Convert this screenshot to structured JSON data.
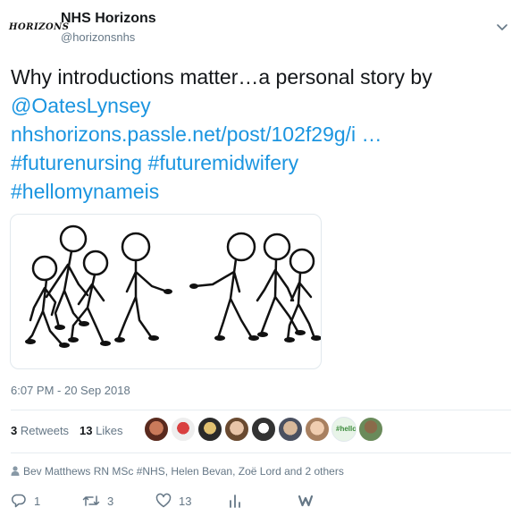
{
  "header": {
    "logo_text": "HORIZONS",
    "name": "NHS Horizons",
    "handle": "@horizonsnhs",
    "menu_icon": "chevron-down-icon"
  },
  "tweet": {
    "text_plain": "Why introductions matter…a personal story by ",
    "mention": "@OatesLynsey",
    "link": "nhshorizons.passle.net/post/102f29g/i …",
    "hashtag1": "#futurenursing",
    "hashtag2": "#futuremidwifery",
    "hashtag3": "#hellomynameis",
    "link_color": "#1b95e0"
  },
  "media": {
    "description_icon": "stick-figures-illustration"
  },
  "timestamp": "6:07 PM - 20 Sep 2018",
  "stats": {
    "retweets_count": "3",
    "retweets_label": "Retweets",
    "likes_count": "13",
    "likes_label": "Likes"
  },
  "liked_by": "Bev Matthews RN MSc #NHS, Helen Bevan, Zoë Lord and 2 others",
  "actions": {
    "replies": "1",
    "retweets": "3",
    "likes": "13"
  }
}
